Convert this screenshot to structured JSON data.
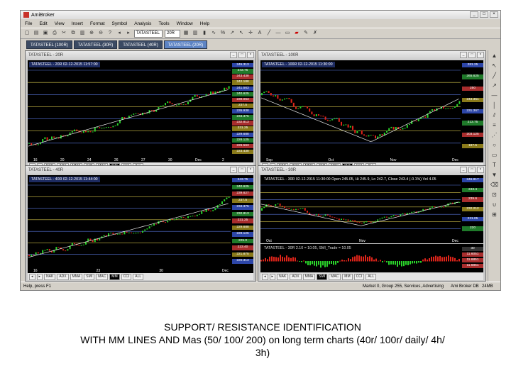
{
  "window": {
    "title": "AmiBroker",
    "buttons": [
      "_",
      "□",
      "×"
    ]
  },
  "menu": [
    "File",
    "Edit",
    "View",
    "Insert",
    "Format",
    "Symbol",
    "Analysis",
    "Tools",
    "Window",
    "Help"
  ],
  "toolbar": {
    "symbol": "TATASTEEL",
    "interval": "20R"
  },
  "tabs": [
    "TATASTEEL (100R)",
    "TATASTEEL (30R)",
    "TATASTEEL (40R)",
    "TATASTEEL (20R)"
  ],
  "panes": [
    {
      "title": "TATASTEEL - 20R",
      "info": "TATASTEEL - 20R 02-12-2015 11:57:00",
      "prices": [
        "245.313",
        "243.75",
        "243.438",
        "242.188",
        "241.563",
        "240.625",
        "239.063",
        "237.5",
        "235.938",
        "234.375",
        "232.813",
        "231.25",
        "229.688",
        "228.125",
        "226.563",
        "223.438"
      ],
      "xlabels": [
        "16",
        "20",
        "24",
        "26",
        "27",
        "30",
        "Dec",
        "2"
      ],
      "tabs": [
        "NAK",
        "ADX",
        "MMA",
        "SMI",
        "MAC",
        "MM",
        "CCI",
        "ALL"
      ],
      "selected_tab": "MM"
    },
    {
      "title": "TATASTEEL - 100R",
      "info": "TATASTEEL - 100R 02-12-2015 11:30:00",
      "prices": [
        "281.25",
        "265.625",
        "250",
        "243.351",
        "231.367",
        "213.75",
        "203.125",
        "187.5"
      ],
      "xlabels": [
        "Sep",
        "Oct",
        "Nov",
        "Dec"
      ],
      "tabs": [
        "NAK",
        "ADX",
        "MMA",
        "SMI",
        "MAC",
        "MM",
        "CCI",
        "ALL"
      ],
      "selected_tab": "MM"
    },
    {
      "title": "TATASTEEL - 40R",
      "info": "TATASTEEL - 40R 02-12-2015 11:44:00",
      "prices": [
        "243.75",
        "240.625",
        "239.627",
        "237.5",
        "234.375",
        "232.813",
        "231.25",
        "229.688",
        "228.125",
        "225.0",
        "223.40",
        "221.875",
        "220.313"
      ],
      "xlabels": [
        "16",
        "23",
        "30",
        "Dec"
      ],
      "tabs": [
        "NAK",
        "ADX",
        "MMA",
        "SMI",
        "MAC",
        "MM",
        "CCI",
        "ALL"
      ],
      "selected_tab": "MM"
    },
    {
      "title": "TATASTEEL - 30R",
      "info": "TATASTEEL - 30R 02-12-2015 11:30:00 Open 245.05, Hi 245.9, Lo 242.7, Close 243.4 (-0.1%) Vol 4.05",
      "prices": [
        "246.817",
        "243.4",
        "239.6",
        "232.212",
        "221.05",
        "220"
      ],
      "xlabels": [
        "Oct",
        "Nov",
        "Dec"
      ],
      "sub_info": "TATASTEEL - 30R 2.10 = 10.05, SMI_Trade = 10.05",
      "sub_prices": [
        "30",
        "11.6051",
        "11.6851",
        "11.6851"
      ],
      "tabs": [
        "NAK",
        "ADX",
        "MMA",
        "SMI",
        "MAC",
        "MM",
        "CCI",
        "ALL"
      ],
      "selected_tab": "SMI"
    }
  ],
  "status": {
    "left": "Help, press F1",
    "mid": "Market 0, Group 255, Services, Advertising",
    "right": "Ami Broker DB",
    "memory": "24MB"
  },
  "caption": {
    "line1": "SUPPORT/ RESISTANCE IDENTIFICATION",
    "line2": "WITH MM LINES AND Mas (50/ 100/ 200) on long term charts (40r/ 100r/ daily/ 4h/",
    "line3": "3h)"
  }
}
